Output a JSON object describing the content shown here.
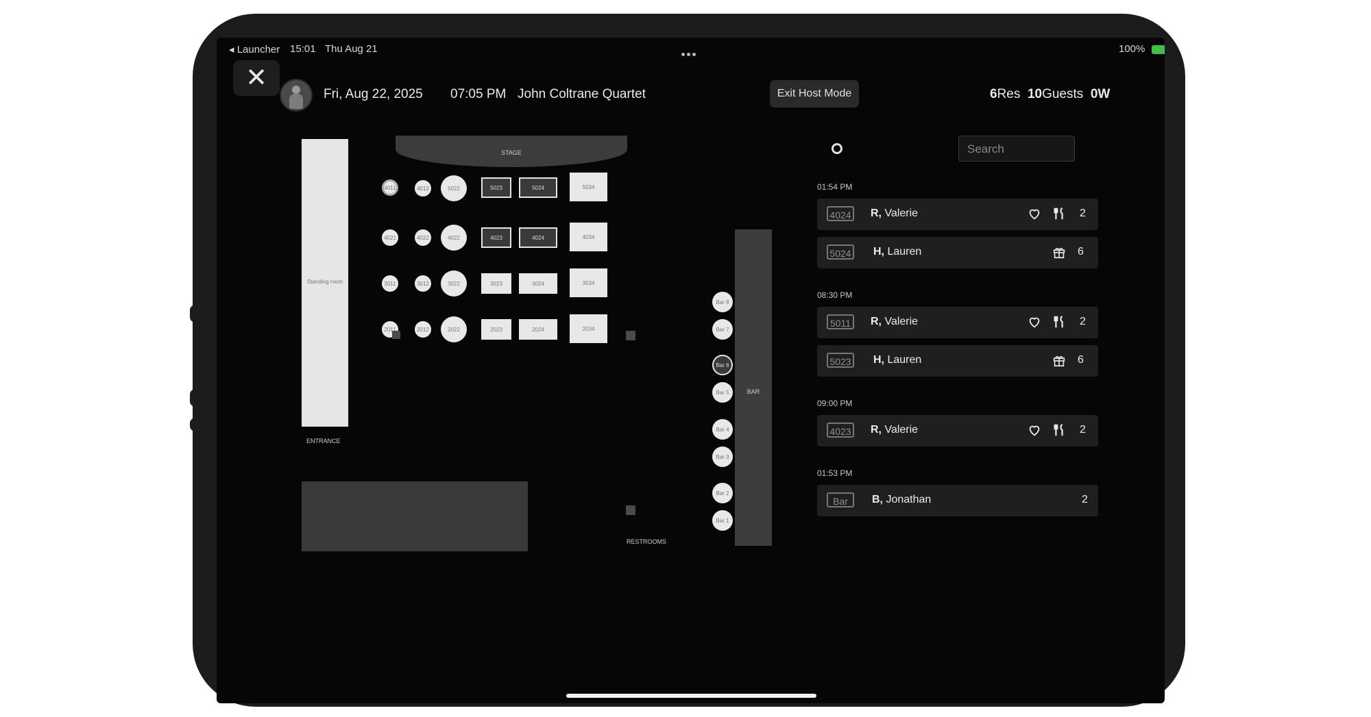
{
  "status_bar": {
    "back_label": "◂ Launcher",
    "time": "15:01",
    "date": "Thu Aug 21",
    "battery": "100%"
  },
  "header": {
    "date": "Fri, Aug 22, 2025",
    "time": "07:05 PM",
    "event": "John Coltrane Quartet",
    "exit_label": "Exit Host Mode",
    "res_count": "6",
    "res_label": "Res",
    "guests_count": "10",
    "guests_label": "Guests",
    "waitlist": "0W"
  },
  "floor": {
    "standing_label": "Standing room",
    "stage_label": "STAGE",
    "entrance_label": "ENTRANCE",
    "restrooms_label": "RESTROOMS",
    "bar_label": "BAR",
    "tables": {
      "r4011": "4011",
      "r4012": "4012",
      "r5022": "5022",
      "t5023": "5023",
      "t5024": "5024",
      "t5034": "5034",
      "r4021": "4021",
      "r4022": "4022",
      "r4022b": "4022",
      "t4023": "4023",
      "t4024": "4024",
      "t4034": "4034",
      "r3011": "3011",
      "r3012": "3012",
      "r3022": "3022",
      "t3023": "3023",
      "t3024": "3024",
      "t3034": "3034",
      "r2011": "2011",
      "r2012": "2012",
      "r2022": "2022",
      "t2023": "2023",
      "t2024": "2024",
      "t2034": "2034"
    },
    "bar_seats": [
      "Bar 8",
      "Bar 7",
      "Bar 6",
      "Bar 5",
      "Bar 4",
      "Bar 3",
      "Bar 2",
      "Bar 1"
    ]
  },
  "search": {
    "placeholder": "Search"
  },
  "reservations": [
    {
      "time": "01:54 PM",
      "items": [
        {
          "table": "4024",
          "initial": "R,",
          "name": "Valerie",
          "icons": [
            "heart-icon",
            "utensils-icon"
          ],
          "count": "2"
        },
        {
          "table": "5024",
          "initial": "H,",
          "name": "Lauren",
          "icons": [
            "gift-icon"
          ],
          "count": "6"
        }
      ]
    },
    {
      "time": "08:30 PM",
      "items": [
        {
          "table": "5011",
          "initial": "R,",
          "name": "Valerie",
          "icons": [
            "heart-icon",
            "utensils-icon"
          ],
          "count": "2"
        },
        {
          "table": "5023",
          "initial": "H,",
          "name": "Lauren",
          "icons": [
            "gift-icon"
          ],
          "count": "6"
        }
      ]
    },
    {
      "time": "09:00 PM",
      "items": [
        {
          "table": "4023",
          "initial": "R,",
          "name": "Valerie",
          "icons": [
            "heart-icon",
            "utensils-icon"
          ],
          "count": "2"
        }
      ]
    },
    {
      "time": "01:53 PM",
      "items": [
        {
          "table": "Bar",
          "initial": "B,",
          "name": "Jonathan",
          "icons": [],
          "count": "2"
        }
      ]
    }
  ]
}
